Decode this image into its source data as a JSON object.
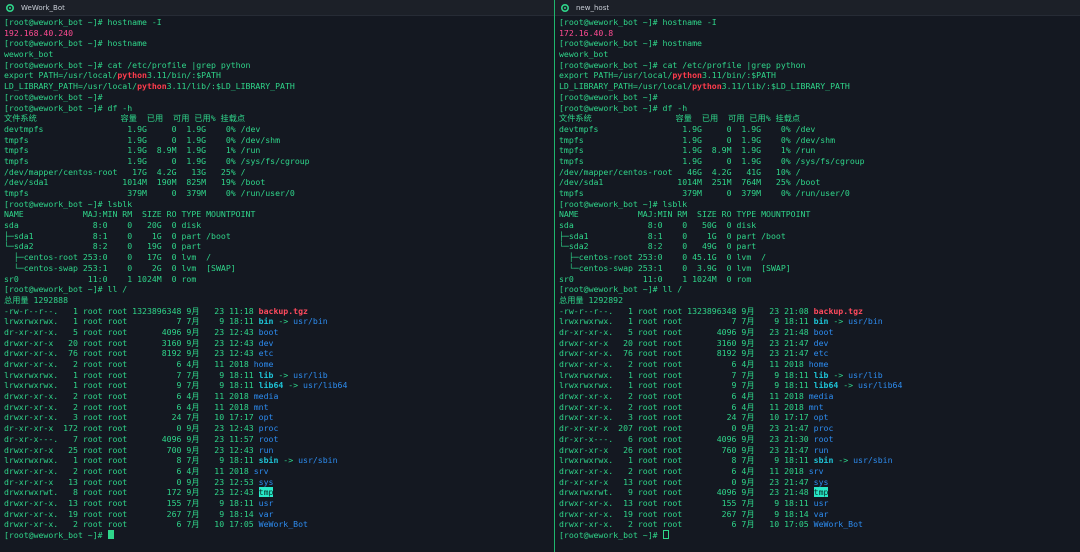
{
  "colors": {
    "default": "#2fd58a",
    "ip": "#ff4b92",
    "directory": "#2d8cf0",
    "symlink": "#1ec3d6",
    "archive": "#ff4a5d",
    "divider": "#1fb56e"
  },
  "panes": [
    {
      "title": "WeWork_Bot",
      "icon": "gear-icon",
      "cursor_style": "solid",
      "lines": [
        [
          [
            "plain",
            "[root@wework_bot ~]# hostname -I"
          ]
        ],
        [
          [
            "ip",
            "192.168.40.240"
          ]
        ],
        [
          [
            "plain",
            "[root@wework_bot ~]# hostname"
          ]
        ],
        [
          [
            "plain",
            "wework_bot"
          ]
        ],
        [
          [
            "plain",
            "[root@wework_bot ~]# cat /etc/profile |grep python"
          ]
        ],
        [
          [
            "plain",
            "export PATH=/usr/local/"
          ],
          [
            "hl",
            "python"
          ],
          [
            "plain",
            "3.11/bin/:$PATH"
          ]
        ],
        [
          [
            "plain",
            "LD_LIBRARY_PATH=/usr/local/"
          ],
          [
            "hl",
            "python"
          ],
          [
            "plain",
            "3.11/lib/:$LD_LIBRARY_PATH"
          ]
        ],
        [
          [
            "plain",
            "[root@wework_bot ~]#"
          ]
        ],
        [
          [
            "plain",
            "[root@wework_bot ~]# df -h"
          ]
        ],
        [
          [
            "plain",
            "文件系统                 容量  已用  可用 已用% 挂载点"
          ]
        ],
        [
          [
            "plain",
            "devtmpfs                 1.9G     0  1.9G    0% /dev"
          ]
        ],
        [
          [
            "plain",
            "tmpfs                    1.9G     0  1.9G    0% /dev/shm"
          ]
        ],
        [
          [
            "plain",
            "tmpfs                    1.9G  8.9M  1.9G    1% /run"
          ]
        ],
        [
          [
            "plain",
            "tmpfs                    1.9G     0  1.9G    0% /sys/fs/cgroup"
          ]
        ],
        [
          [
            "plain",
            "/dev/mapper/centos-root   17G  4.2G   13G   25% /"
          ]
        ],
        [
          [
            "plain",
            "/dev/sda1               1014M  190M  825M   19% /boot"
          ]
        ],
        [
          [
            "plain",
            "tmpfs                    379M     0  379M    0% /run/user/0"
          ]
        ],
        [
          [
            "plain",
            "[root@wework_bot ~]# lsblk"
          ]
        ],
        [
          [
            "plain",
            "NAME            MAJ:MIN RM  SIZE RO TYPE MOUNTPOINT"
          ]
        ],
        [
          [
            "plain",
            "sda               8:0    0   20G  0 disk"
          ]
        ],
        [
          [
            "plain",
            "├─sda1            8:1    0    1G  0 part /boot"
          ]
        ],
        [
          [
            "plain",
            "└─sda2            8:2    0   19G  0 part"
          ]
        ],
        [
          [
            "plain",
            "  ├─centos-root 253:0    0   17G  0 lvm  /"
          ]
        ],
        [
          [
            "plain",
            "  └─centos-swap 253:1    0    2G  0 lvm  [SWAP]"
          ]
        ],
        [
          [
            "plain",
            "sr0              11:0    1 1024M  0 rom"
          ]
        ],
        [
          [
            "plain",
            "[root@wework_bot ~]# ll /"
          ]
        ],
        [
          [
            "plain",
            "总用量 1292888"
          ]
        ],
        [
          [
            "plain",
            "-rw-r--r--.   1 root root 1323896348 9月   23 11:18 "
          ],
          [
            "archive",
            "backup.tgz"
          ]
        ],
        [
          [
            "plain",
            "lrwxrwxrwx.   1 root root          7 7月    9 18:11 "
          ],
          [
            "link",
            "bin"
          ],
          [
            "plain",
            " -> "
          ],
          [
            "dir",
            "usr/bin"
          ]
        ],
        [
          [
            "plain",
            "dr-xr-xr-x.   5 root root       4096 9月   23 12:43 "
          ],
          [
            "dir",
            "boot"
          ]
        ],
        [
          [
            "plain",
            "drwxr-xr-x   20 root root       3160 9月   23 12:43 "
          ],
          [
            "dir",
            "dev"
          ]
        ],
        [
          [
            "plain",
            "drwxr-xr-x.  76 root root       8192 9月   23 12:43 "
          ],
          [
            "dir",
            "etc"
          ]
        ],
        [
          [
            "plain",
            "drwxr-xr-x.   2 root root          6 4月   11 2018 "
          ],
          [
            "dir",
            "home"
          ]
        ],
        [
          [
            "plain",
            "lrwxrwxrwx.   1 root root          7 7月    9 18:11 "
          ],
          [
            "link",
            "lib"
          ],
          [
            "plain",
            " -> "
          ],
          [
            "dir",
            "usr/lib"
          ]
        ],
        [
          [
            "plain",
            "lrwxrwxrwx.   1 root root          9 7月    9 18:11 "
          ],
          [
            "link",
            "lib64"
          ],
          [
            "plain",
            " -> "
          ],
          [
            "dir",
            "usr/lib64"
          ]
        ],
        [
          [
            "plain",
            "drwxr-xr-x.   2 root root          6 4月   11 2018 "
          ],
          [
            "dir",
            "media"
          ]
        ],
        [
          [
            "plain",
            "drwxr-xr-x.   2 root root          6 4月   11 2018 "
          ],
          [
            "dir",
            "mnt"
          ]
        ],
        [
          [
            "plain",
            "drwxr-xr-x.   3 root root         24 7月   10 17:17 "
          ],
          [
            "dir",
            "opt"
          ]
        ],
        [
          [
            "plain",
            "dr-xr-xr-x  172 root root          0 9月   23 12:43 "
          ],
          [
            "dir",
            "proc"
          ]
        ],
        [
          [
            "plain",
            "dr-xr-x---.   7 root root       4096 9月   23 11:57 "
          ],
          [
            "dir",
            "root"
          ]
        ],
        [
          [
            "plain",
            "drwxr-xr-x   25 root root        700 9月   23 12:43 "
          ],
          [
            "dir",
            "run"
          ]
        ],
        [
          [
            "plain",
            "lrwxrwxrwx.   1 root root          8 7月    9 18:11 "
          ],
          [
            "link",
            "sbin"
          ],
          [
            "plain",
            " -> "
          ],
          [
            "dir",
            "usr/sbin"
          ]
        ],
        [
          [
            "plain",
            "drwxr-xr-x.   2 root root          6 4月   11 2018 "
          ],
          [
            "dir",
            "srv"
          ]
        ],
        [
          [
            "plain",
            "dr-xr-xr-x   13 root root          0 9月   23 12:53 "
          ],
          [
            "dir",
            "sys"
          ]
        ],
        [
          [
            "plain",
            "drwxrwxrwt.   8 root root        172 9月   23 12:43 "
          ],
          [
            "sticky",
            "tmp"
          ]
        ],
        [
          [
            "plain",
            "drwxr-xr-x.  13 root root        155 7月    9 18:11 "
          ],
          [
            "dir",
            "usr"
          ]
        ],
        [
          [
            "plain",
            "drwxr-xr-x.  19 root root        267 7月    9 18:14 "
          ],
          [
            "dir",
            "var"
          ]
        ],
        [
          [
            "plain",
            "drwxr-xr-x.   2 root root          6 7月   10 17:05 "
          ],
          [
            "dir",
            "WeWork_Bot"
          ]
        ],
        [
          [
            "plain",
            "[root@wework_bot ~]# "
          ]
        ]
      ]
    },
    {
      "title": "new_host",
      "icon": "gear-icon",
      "cursor_style": "hollow",
      "lines": [
        [
          [
            "plain",
            "[root@wework_bot ~]# hostname -I"
          ]
        ],
        [
          [
            "ip",
            "172.16.40.8"
          ]
        ],
        [
          [
            "plain",
            "[root@wework_bot ~]# hostname"
          ]
        ],
        [
          [
            "plain",
            "wework_bot"
          ]
        ],
        [
          [
            "plain",
            "[root@wework_bot ~]# cat /etc/profile |grep python"
          ]
        ],
        [
          [
            "plain",
            "export PATH=/usr/local/"
          ],
          [
            "hl",
            "python"
          ],
          [
            "plain",
            "3.11/bin/:$PATH"
          ]
        ],
        [
          [
            "plain",
            "LD_LIBRARY_PATH=/usr/local/"
          ],
          [
            "hl",
            "python"
          ],
          [
            "plain",
            "3.11/lib/:$LD_LIBRARY_PATH"
          ]
        ],
        [
          [
            "plain",
            "[root@wework_bot ~]#"
          ]
        ],
        [
          [
            "plain",
            "[root@wework_bot ~]# df -h"
          ]
        ],
        [
          [
            "plain",
            "文件系统                 容量  已用  可用 已用% 挂载点"
          ]
        ],
        [
          [
            "plain",
            "devtmpfs                 1.9G     0  1.9G    0% /dev"
          ]
        ],
        [
          [
            "plain",
            "tmpfs                    1.9G     0  1.9G    0% /dev/shm"
          ]
        ],
        [
          [
            "plain",
            "tmpfs                    1.9G  8.9M  1.9G    1% /run"
          ]
        ],
        [
          [
            "plain",
            "tmpfs                    1.9G     0  1.9G    0% /sys/fs/cgroup"
          ]
        ],
        [
          [
            "plain",
            "/dev/mapper/centos-root   46G  4.2G   41G   10% /"
          ]
        ],
        [
          [
            "plain",
            "/dev/sda1               1014M  251M  764M   25% /boot"
          ]
        ],
        [
          [
            "plain",
            "tmpfs                    379M     0  379M    0% /run/user/0"
          ]
        ],
        [
          [
            "plain",
            "[root@wework_bot ~]# lsblk"
          ]
        ],
        [
          [
            "plain",
            "NAME            MAJ:MIN RM  SIZE RO TYPE MOUNTPOINT"
          ]
        ],
        [
          [
            "plain",
            "sda               8:0    0   50G  0 disk"
          ]
        ],
        [
          [
            "plain",
            "├─sda1            8:1    0    1G  0 part /boot"
          ]
        ],
        [
          [
            "plain",
            "└─sda2            8:2    0   49G  0 part"
          ]
        ],
        [
          [
            "plain",
            "  ├─centos-root 253:0    0 45.1G  0 lvm  /"
          ]
        ],
        [
          [
            "plain",
            "  └─centos-swap 253:1    0  3.9G  0 lvm  [SWAP]"
          ]
        ],
        [
          [
            "plain",
            "sr0              11:0    1 1024M  0 rom"
          ]
        ],
        [
          [
            "plain",
            "[root@wework_bot ~]# ll /"
          ]
        ],
        [
          [
            "plain",
            "总用量 1292892"
          ]
        ],
        [
          [
            "plain",
            "-rw-r--r--.   1 root root 1323896348 9月   23 21:08 "
          ],
          [
            "archive",
            "backup.tgz"
          ]
        ],
        [
          [
            "plain",
            "lrwxrwxrwx.   1 root root          7 7月    9 18:11 "
          ],
          [
            "link",
            "bin"
          ],
          [
            "plain",
            " -> "
          ],
          [
            "dir",
            "usr/bin"
          ]
        ],
        [
          [
            "plain",
            "dr-xr-xr-x.   5 root root       4096 9月   23 21:48 "
          ],
          [
            "dir",
            "boot"
          ]
        ],
        [
          [
            "plain",
            "drwxr-xr-x   20 root root       3160 9月   23 21:47 "
          ],
          [
            "dir",
            "dev"
          ]
        ],
        [
          [
            "plain",
            "drwxr-xr-x.  76 root root       8192 9月   23 21:47 "
          ],
          [
            "dir",
            "etc"
          ]
        ],
        [
          [
            "plain",
            "drwxr-xr-x.   2 root root          6 4月   11 2018 "
          ],
          [
            "dir",
            "home"
          ]
        ],
        [
          [
            "plain",
            "lrwxrwxrwx.   1 root root          7 7月    9 18:11 "
          ],
          [
            "link",
            "lib"
          ],
          [
            "plain",
            " -> "
          ],
          [
            "dir",
            "usr/lib"
          ]
        ],
        [
          [
            "plain",
            "lrwxrwxrwx.   1 root root          9 7月    9 18:11 "
          ],
          [
            "link",
            "lib64"
          ],
          [
            "plain",
            " -> "
          ],
          [
            "dir",
            "usr/lib64"
          ]
        ],
        [
          [
            "plain",
            "drwxr-xr-x.   2 root root          6 4月   11 2018 "
          ],
          [
            "dir",
            "media"
          ]
        ],
        [
          [
            "plain",
            "drwxr-xr-x.   2 root root          6 4月   11 2018 "
          ],
          [
            "dir",
            "mnt"
          ]
        ],
        [
          [
            "plain",
            "drwxr-xr-x.   3 root root         24 7月   10 17:17 "
          ],
          [
            "dir",
            "opt"
          ]
        ],
        [
          [
            "plain",
            "dr-xr-xr-x  207 root root          0 9月   23 21:47 "
          ],
          [
            "dir",
            "proc"
          ]
        ],
        [
          [
            "plain",
            "dr-xr-x---.   6 root root       4096 9月   23 21:30 "
          ],
          [
            "dir",
            "root"
          ]
        ],
        [
          [
            "plain",
            "drwxr-xr-x   26 root root        760 9月   23 21:47 "
          ],
          [
            "dir",
            "run"
          ]
        ],
        [
          [
            "plain",
            "lrwxrwxrwx.   1 root root          8 7月    9 18:11 "
          ],
          [
            "link",
            "sbin"
          ],
          [
            "plain",
            " -> "
          ],
          [
            "dir",
            "usr/sbin"
          ]
        ],
        [
          [
            "plain",
            "drwxr-xr-x.   2 root root          6 4月   11 2018 "
          ],
          [
            "dir",
            "srv"
          ]
        ],
        [
          [
            "plain",
            "dr-xr-xr-x   13 root root          0 9月   23 21:47 "
          ],
          [
            "dir",
            "sys"
          ]
        ],
        [
          [
            "plain",
            "drwxrwxrwt.   9 root root       4096 9月   23 21:48 "
          ],
          [
            "sticky",
            "tmp"
          ]
        ],
        [
          [
            "plain",
            "drwxr-xr-x.  13 root root        155 7月    9 18:11 "
          ],
          [
            "dir",
            "usr"
          ]
        ],
        [
          [
            "plain",
            "drwxr-xr-x.  19 root root        267 7月    9 18:14 "
          ],
          [
            "dir",
            "var"
          ]
        ],
        [
          [
            "plain",
            "drwxr-xr-x.   2 root root          6 7月   10 17:05 "
          ],
          [
            "dir",
            "WeWork_Bot"
          ]
        ],
        [
          [
            "plain",
            "[root@wework_bot ~]# "
          ]
        ]
      ]
    }
  ]
}
